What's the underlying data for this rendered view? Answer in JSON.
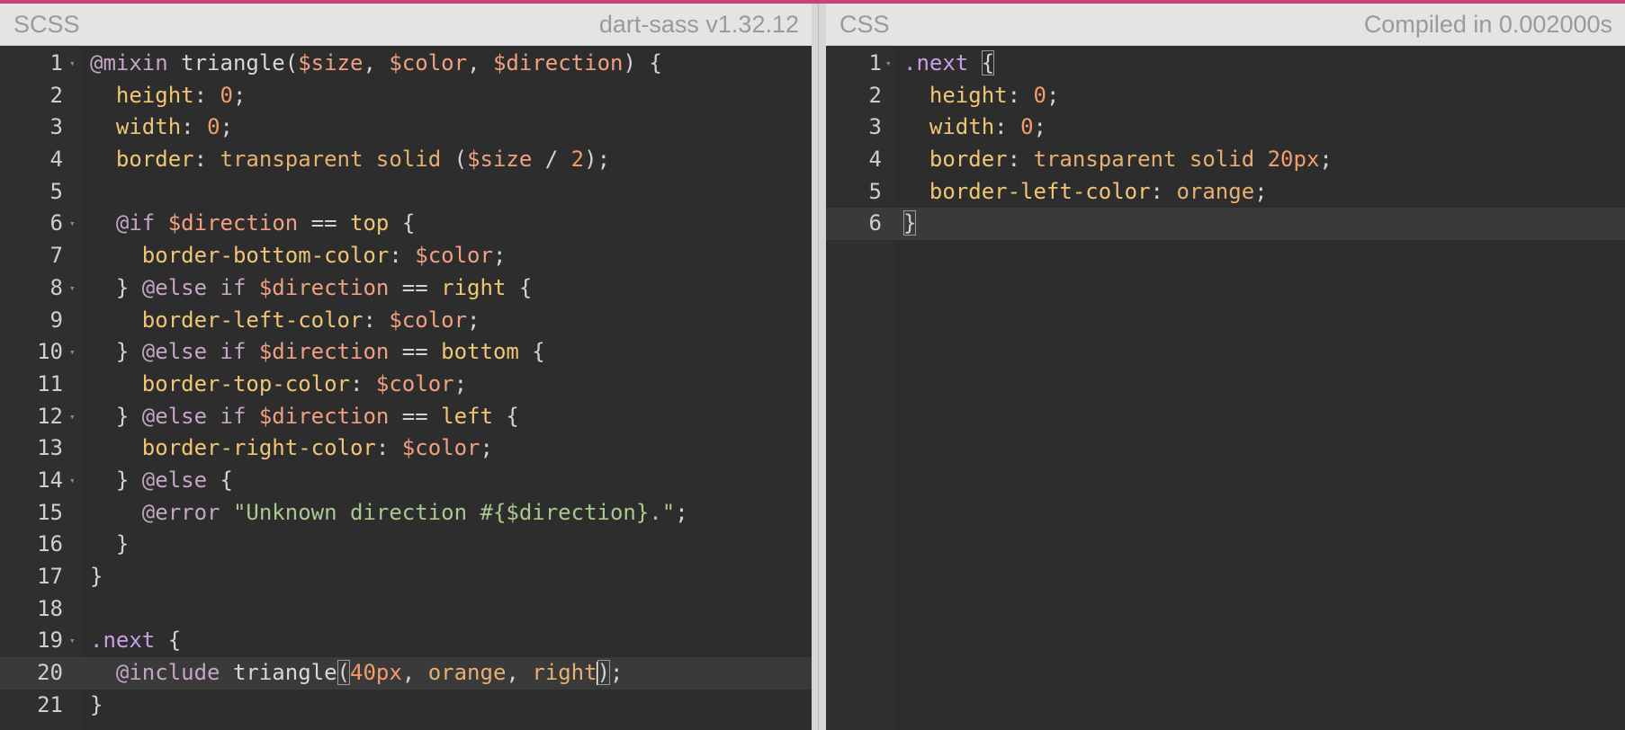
{
  "colors": {
    "accent_bar": "#c2457a",
    "editor_bg": "#2d2d2d",
    "header_bg": "#e4e4e4",
    "property": "#f0c674",
    "variable": "#f0a080",
    "number": "#f29d6a",
    "at_rule": "#c5a5c5",
    "string": "#a8c98f",
    "selector": "#ca9ee6"
  },
  "scss_pane": {
    "title": "SCSS",
    "compiler": "dart-sass v1.32.12",
    "active_line": 20,
    "lines": [
      {
        "n": "1",
        "fold": true,
        "tokens": [
          [
            "at",
            "@mixin"
          ],
          [
            "id",
            " triangle("
          ],
          [
            "var",
            "$size"
          ],
          [
            "p",
            ", "
          ],
          [
            "var",
            "$color"
          ],
          [
            "p",
            ", "
          ],
          [
            "var",
            "$direction"
          ],
          [
            "p",
            ") {"
          ]
        ]
      },
      {
        "n": "2",
        "tokens": [
          [
            "p",
            "  "
          ],
          [
            "prop",
            "height"
          ],
          [
            "p",
            ": "
          ],
          [
            "num",
            "0"
          ],
          [
            "p",
            ";"
          ]
        ]
      },
      {
        "n": "3",
        "tokens": [
          [
            "p",
            "  "
          ],
          [
            "prop",
            "width"
          ],
          [
            "p",
            ": "
          ],
          [
            "num",
            "0"
          ],
          [
            "p",
            ";"
          ]
        ]
      },
      {
        "n": "4",
        "tokens": [
          [
            "p",
            "  "
          ],
          [
            "prop",
            "border"
          ],
          [
            "p",
            ": "
          ],
          [
            "val",
            "transparent solid"
          ],
          [
            "p",
            " ("
          ],
          [
            "var",
            "$size"
          ],
          [
            "p",
            " / "
          ],
          [
            "num",
            "2"
          ],
          [
            "p",
            ");"
          ]
        ]
      },
      {
        "n": "5",
        "tokens": []
      },
      {
        "n": "6",
        "fold": true,
        "tokens": [
          [
            "p",
            "  "
          ],
          [
            "at",
            "@if"
          ],
          [
            "p",
            " "
          ],
          [
            "var",
            "$direction"
          ],
          [
            "p",
            " == "
          ],
          [
            "prop",
            "top"
          ],
          [
            "p",
            " {"
          ]
        ]
      },
      {
        "n": "7",
        "tokens": [
          [
            "p",
            "    "
          ],
          [
            "prop",
            "border-bottom-color"
          ],
          [
            "p",
            ": "
          ],
          [
            "var",
            "$color"
          ],
          [
            "p",
            ";"
          ]
        ]
      },
      {
        "n": "8",
        "fold": true,
        "tokens": [
          [
            "p",
            "  } "
          ],
          [
            "at",
            "@else if"
          ],
          [
            "p",
            " "
          ],
          [
            "var",
            "$direction"
          ],
          [
            "p",
            " == "
          ],
          [
            "prop",
            "right"
          ],
          [
            "p",
            " {"
          ]
        ]
      },
      {
        "n": "9",
        "tokens": [
          [
            "p",
            "    "
          ],
          [
            "prop",
            "border-left-color"
          ],
          [
            "p",
            ": "
          ],
          [
            "var",
            "$color"
          ],
          [
            "p",
            ";"
          ]
        ]
      },
      {
        "n": "10",
        "fold": true,
        "tokens": [
          [
            "p",
            "  } "
          ],
          [
            "at",
            "@else if"
          ],
          [
            "p",
            " "
          ],
          [
            "var",
            "$direction"
          ],
          [
            "p",
            " == "
          ],
          [
            "prop",
            "bottom"
          ],
          [
            "p",
            " {"
          ]
        ]
      },
      {
        "n": "11",
        "tokens": [
          [
            "p",
            "    "
          ],
          [
            "prop",
            "border-top-color"
          ],
          [
            "p",
            ": "
          ],
          [
            "var",
            "$color"
          ],
          [
            "p",
            ";"
          ]
        ]
      },
      {
        "n": "12",
        "fold": true,
        "tokens": [
          [
            "p",
            "  } "
          ],
          [
            "at",
            "@else if"
          ],
          [
            "p",
            " "
          ],
          [
            "var",
            "$direction"
          ],
          [
            "p",
            " == "
          ],
          [
            "prop",
            "left"
          ],
          [
            "p",
            " {"
          ]
        ]
      },
      {
        "n": "13",
        "tokens": [
          [
            "p",
            "    "
          ],
          [
            "prop",
            "border-right-color"
          ],
          [
            "p",
            ": "
          ],
          [
            "var",
            "$color"
          ],
          [
            "p",
            ";"
          ]
        ]
      },
      {
        "n": "14",
        "fold": true,
        "tokens": [
          [
            "p",
            "  } "
          ],
          [
            "at",
            "@else"
          ],
          [
            "p",
            " {"
          ]
        ]
      },
      {
        "n": "15",
        "tokens": [
          [
            "p",
            "    "
          ],
          [
            "at",
            "@error"
          ],
          [
            "p",
            " "
          ],
          [
            "str",
            "\"Unknown direction #{$direction}.\""
          ],
          [
            "p",
            ";"
          ]
        ]
      },
      {
        "n": "16",
        "tokens": [
          [
            "p",
            "  }"
          ]
        ]
      },
      {
        "n": "17",
        "tokens": [
          [
            "p",
            "}"
          ]
        ]
      },
      {
        "n": "18",
        "tokens": []
      },
      {
        "n": "19",
        "fold": true,
        "tokens": [
          [
            "sel",
            ".next"
          ],
          [
            "p",
            " {"
          ]
        ]
      },
      {
        "n": "20",
        "tokens": [
          [
            "p",
            "  "
          ],
          [
            "at",
            "@include"
          ],
          [
            "id",
            " triangle"
          ],
          [
            "bm",
            "("
          ],
          [
            "num",
            "40px"
          ],
          [
            "p",
            ", "
          ],
          [
            "val",
            "orange"
          ],
          [
            "p",
            ", "
          ],
          [
            "val",
            "right"
          ],
          [
            "cur",
            ""
          ],
          [
            "bm",
            ")"
          ],
          [
            "p",
            ";"
          ]
        ]
      },
      {
        "n": "21",
        "tokens": [
          [
            "p",
            "}"
          ]
        ]
      }
    ]
  },
  "css_pane": {
    "title": "CSS",
    "status": "Compiled in 0.002000s",
    "active_line": 6,
    "lines": [
      {
        "n": "1",
        "fold": true,
        "tokens": [
          [
            "sel",
            ".next"
          ],
          [
            "p",
            " "
          ],
          [
            "bm",
            "{"
          ]
        ]
      },
      {
        "n": "2",
        "tokens": [
          [
            "p",
            "  "
          ],
          [
            "prop",
            "height"
          ],
          [
            "p",
            ": "
          ],
          [
            "num",
            "0"
          ],
          [
            "p",
            ";"
          ]
        ]
      },
      {
        "n": "3",
        "tokens": [
          [
            "p",
            "  "
          ],
          [
            "prop",
            "width"
          ],
          [
            "p",
            ": "
          ],
          [
            "num",
            "0"
          ],
          [
            "p",
            ";"
          ]
        ]
      },
      {
        "n": "4",
        "tokens": [
          [
            "p",
            "  "
          ],
          [
            "prop",
            "border"
          ],
          [
            "p",
            ": "
          ],
          [
            "val",
            "transparent solid"
          ],
          [
            "p",
            " "
          ],
          [
            "num",
            "20px"
          ],
          [
            "p",
            ";"
          ]
        ]
      },
      {
        "n": "5",
        "tokens": [
          [
            "p",
            "  "
          ],
          [
            "prop",
            "border-left-color"
          ],
          [
            "p",
            ": "
          ],
          [
            "val",
            "orange"
          ],
          [
            "p",
            ";"
          ]
        ]
      },
      {
        "n": "6",
        "tokens": [
          [
            "bm",
            "}"
          ]
        ]
      }
    ]
  }
}
